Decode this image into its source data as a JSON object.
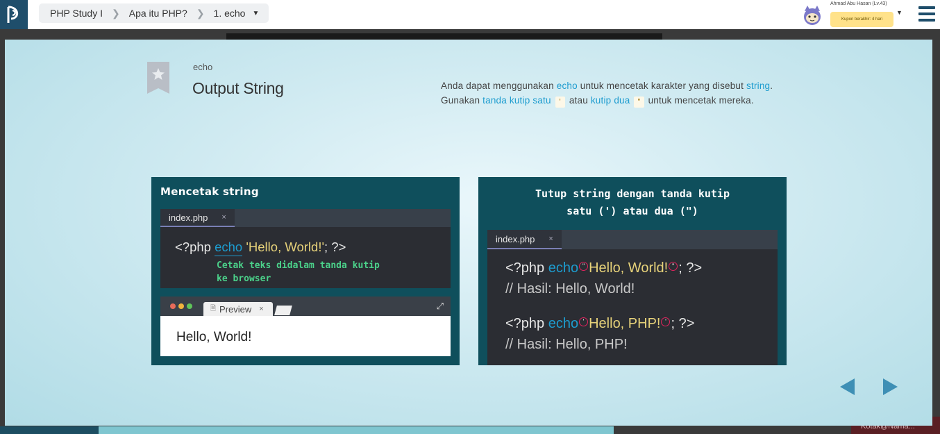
{
  "breadcrumb": {
    "items": [
      "PHP Study I",
      "Apa itu PHP?",
      "1. echo"
    ]
  },
  "user": {
    "name": "Ahmad Abu Hasan (Lv.43)",
    "coupon": "Kupon berakhir: 4 hari"
  },
  "bottom_right_label": "Kotak@Nama...",
  "slide": {
    "kicker": "echo",
    "title": "Output String",
    "desc": {
      "p1": "Anda dapat menggunakan ",
      "k1": "echo",
      "p2": " untuk mencetak karakter yang disebut ",
      "k2": "string",
      "p3": ". Gunakan ",
      "k3": "tanda kutip satu",
      "q1": "'",
      "p4": " atau ",
      "k4": "kutip dua",
      "q2": "\"",
      "p5": " untuk mencetak mereka."
    }
  },
  "left_panel": {
    "heading": "Mencetak string",
    "tab_label": "index.php",
    "tab_close": "×",
    "code_open": "<?php ",
    "code_echo": "echo",
    "code_str": " 'Hello, World!'",
    "code_close": "; ?>",
    "note_line1": "Cetak teks didalam tanda kutip",
    "note_line2": "ke browser",
    "browser_tab": "Preview",
    "browser_tab_close": "×",
    "browser_output": "Hello, World!"
  },
  "right_panel": {
    "heading_line1": "Tutup string dengan tanda kutip",
    "heading_line2": "satu (') atau dua (\")",
    "tab_label": "index.php",
    "tab_close": "×",
    "line1_open": "<?php ",
    "line1_echo": "echo",
    "line1_mark": "\"",
    "line1_str": "Hello, World!",
    "line1_close": "; ?>",
    "line2": "// Hasil: Hello, World!",
    "line3_open": "<?php ",
    "line3_echo": "echo",
    "line3_mark": "'",
    "line3_str": "Hello, PHP!",
    "line3_close": "; ?>",
    "line4": "// Hasil: Hello, PHP!"
  },
  "colors": {
    "accent": "#1d9ccf",
    "panel_bg": "#0f4f5c",
    "editor_bg": "#2b2d33",
    "string": "#e7d27a",
    "note_green": "#4bd18a",
    "nav_arrow": "#3e8fb5"
  },
  "icons": {
    "logo": "progate-logo-icon",
    "bookmark": "bookmark-star-icon",
    "menu": "hamburger-menu-icon",
    "prev": "arrow-left-icon",
    "next": "arrow-right-icon"
  }
}
